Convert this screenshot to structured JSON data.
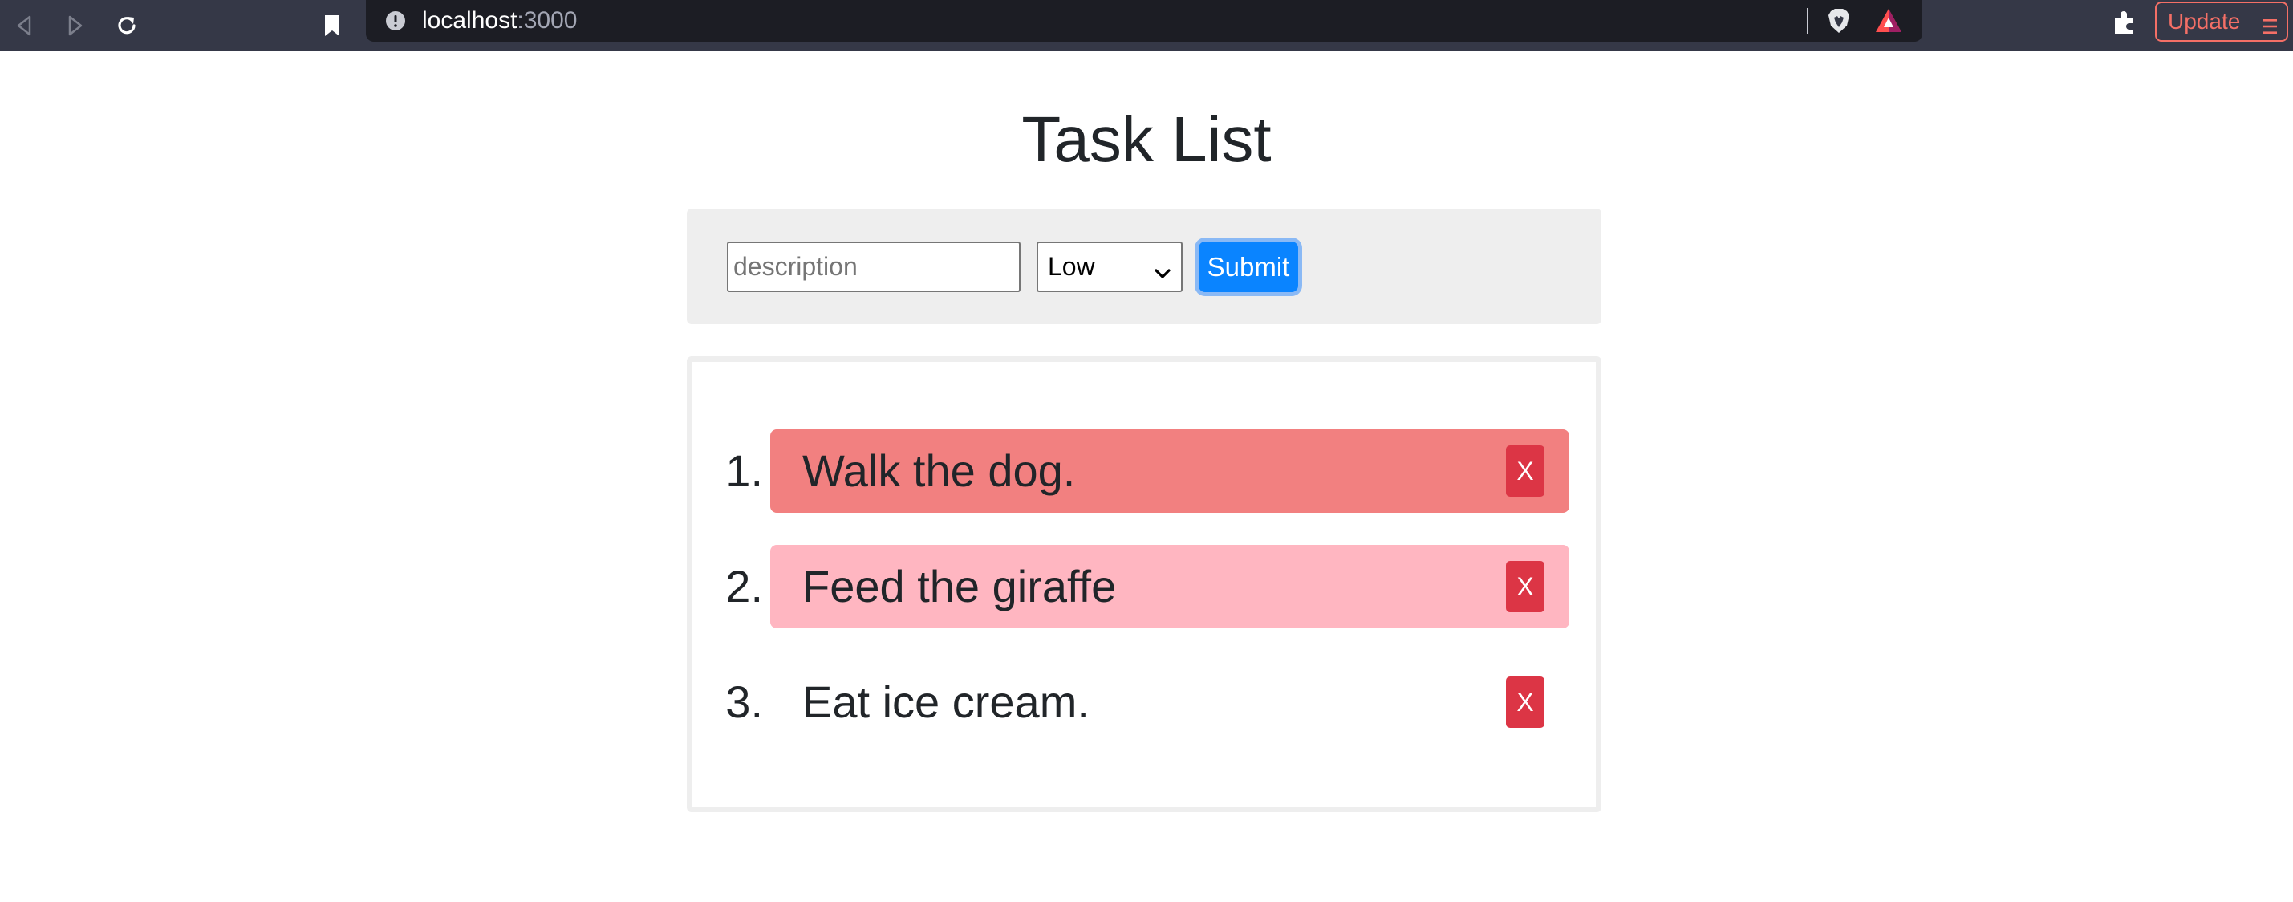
{
  "browser": {
    "url_host": "localhost",
    "url_port": ":3000",
    "update_label": "Update"
  },
  "page": {
    "title": "Task List"
  },
  "form": {
    "description_value": "",
    "description_placeholder": "description",
    "priority_selected": "Low",
    "submit_label": "Submit"
  },
  "tasks": [
    {
      "number": "1.",
      "text": "Walk the dog.",
      "priority_color": "#f28080",
      "delete_label": "X"
    },
    {
      "number": "2.",
      "text": "Feed the giraffe",
      "priority_color": "#ffb6c1",
      "delete_label": "X"
    },
    {
      "number": "3.",
      "text": "Eat ice cream.",
      "priority_color": "#ffffff",
      "delete_label": "X"
    }
  ],
  "colors": {
    "submit": "#0a84ff",
    "delete": "#dc3545",
    "update_accent": "#f46f66"
  }
}
